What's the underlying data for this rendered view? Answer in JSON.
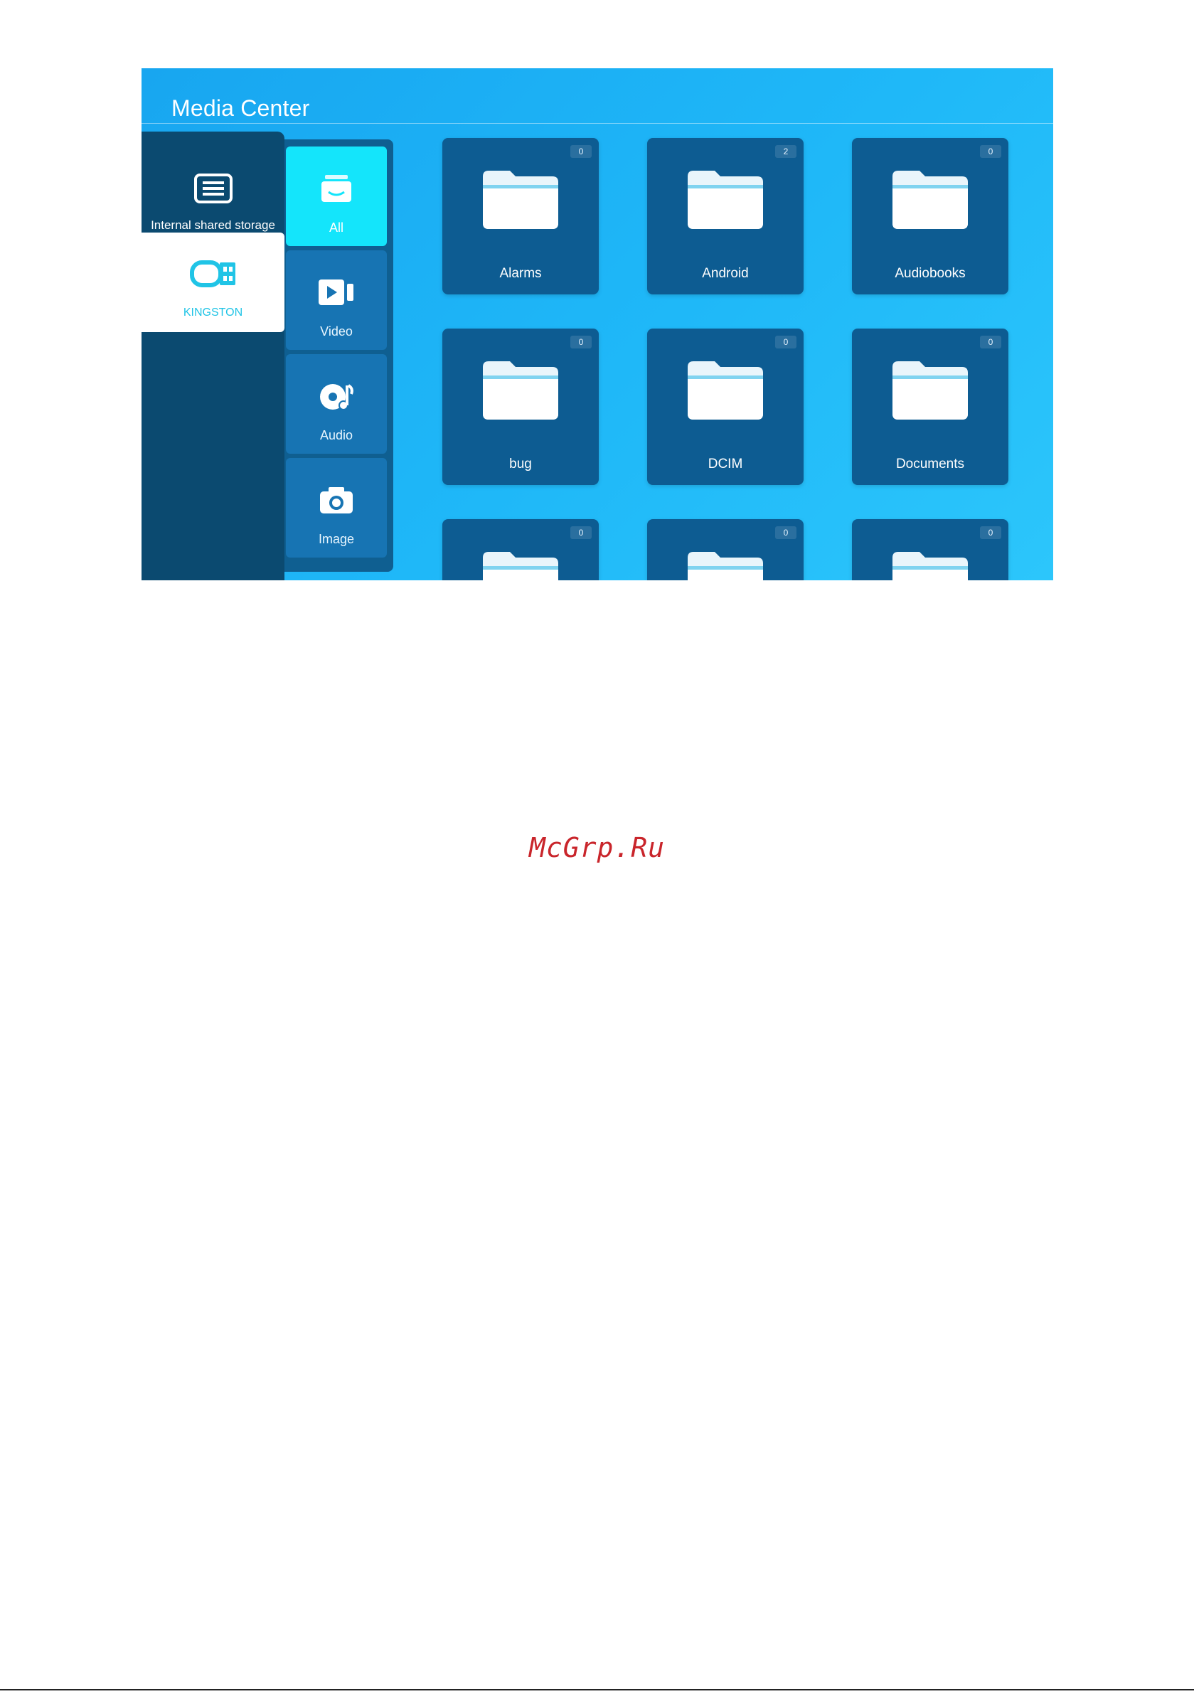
{
  "app": {
    "title": "Media Center"
  },
  "storage": [
    {
      "label": "Internal shared storage",
      "icon": "storage-icon",
      "selected": false
    },
    {
      "label": "KINGSTON",
      "icon": "usb-drive-icon",
      "selected": true
    }
  ],
  "categories": [
    {
      "label": "All",
      "icon": "all-files-icon",
      "active": true
    },
    {
      "label": "Video",
      "icon": "video-icon",
      "active": false
    },
    {
      "label": "Audio",
      "icon": "audio-icon",
      "active": false
    },
    {
      "label": "Image",
      "icon": "camera-icon",
      "active": false
    }
  ],
  "folders": [
    {
      "name": "Alarms",
      "count": "0"
    },
    {
      "name": "Android",
      "count": "2"
    },
    {
      "name": "Audiobooks",
      "count": "0"
    },
    {
      "name": "bug",
      "count": "0"
    },
    {
      "name": "DCIM",
      "count": "0"
    },
    {
      "name": "Documents",
      "count": "0"
    },
    {
      "name": "",
      "count": "0"
    },
    {
      "name": "",
      "count": "0"
    },
    {
      "name": "",
      "count": "0"
    }
  ],
  "watermark": "McGrp.Ru",
  "colors": {
    "background_blue": "#1fb8f8",
    "sidebar_dark": "#0b4a70",
    "tile": "#0d5c92",
    "active_category": "#14e5fb",
    "watermark_red": "#c9252b"
  }
}
